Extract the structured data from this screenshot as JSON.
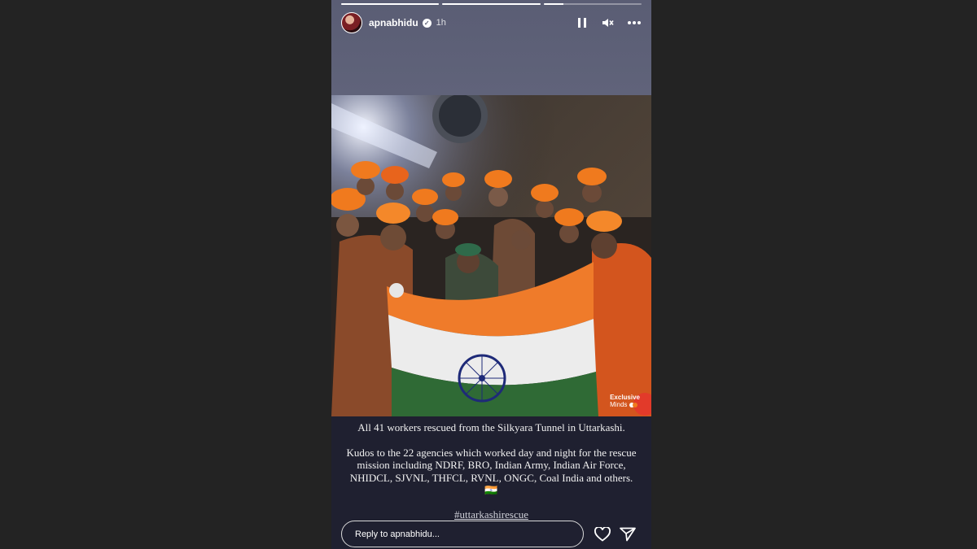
{
  "story": {
    "progress": [
      1.0,
      1.0,
      0.2
    ],
    "username": "apnabhidu",
    "verified_icon": "verified-badge-icon",
    "timestamp": "1h",
    "controls": {
      "pause_icon": "pause-icon",
      "mute_icon": "speaker-muted-icon",
      "more_icon": "more-options-icon"
    },
    "photo": {
      "watermark_line1": "Exclusive",
      "watermark_line2": "Minds"
    },
    "caption": {
      "line1": "All 41 workers rescued from the Silkyara Tunnel in Uttarkashi.",
      "line2": "Kudos to the 22 agencies which worked day and night for the rescue mission including NDRF, BRO, Indian Army, Indian Air Force, NHIDCL, SJVNL, THFCL, RVNL, ONGC, Coal India and others. 🇮🇳"
    },
    "hashtag": "#uttarkashirescue",
    "reply": {
      "placeholder": "Reply to apnabhidu...",
      "like_icon": "heart-icon",
      "share_icon": "send-icon"
    }
  },
  "colors": {
    "page_bg": "#232323",
    "story_top": "#5a5d74",
    "story_bottom": "#1f2030",
    "flag_saffron": "#ef7b2a",
    "flag_green": "#2f6a35",
    "chakra": "#1e2a78"
  }
}
